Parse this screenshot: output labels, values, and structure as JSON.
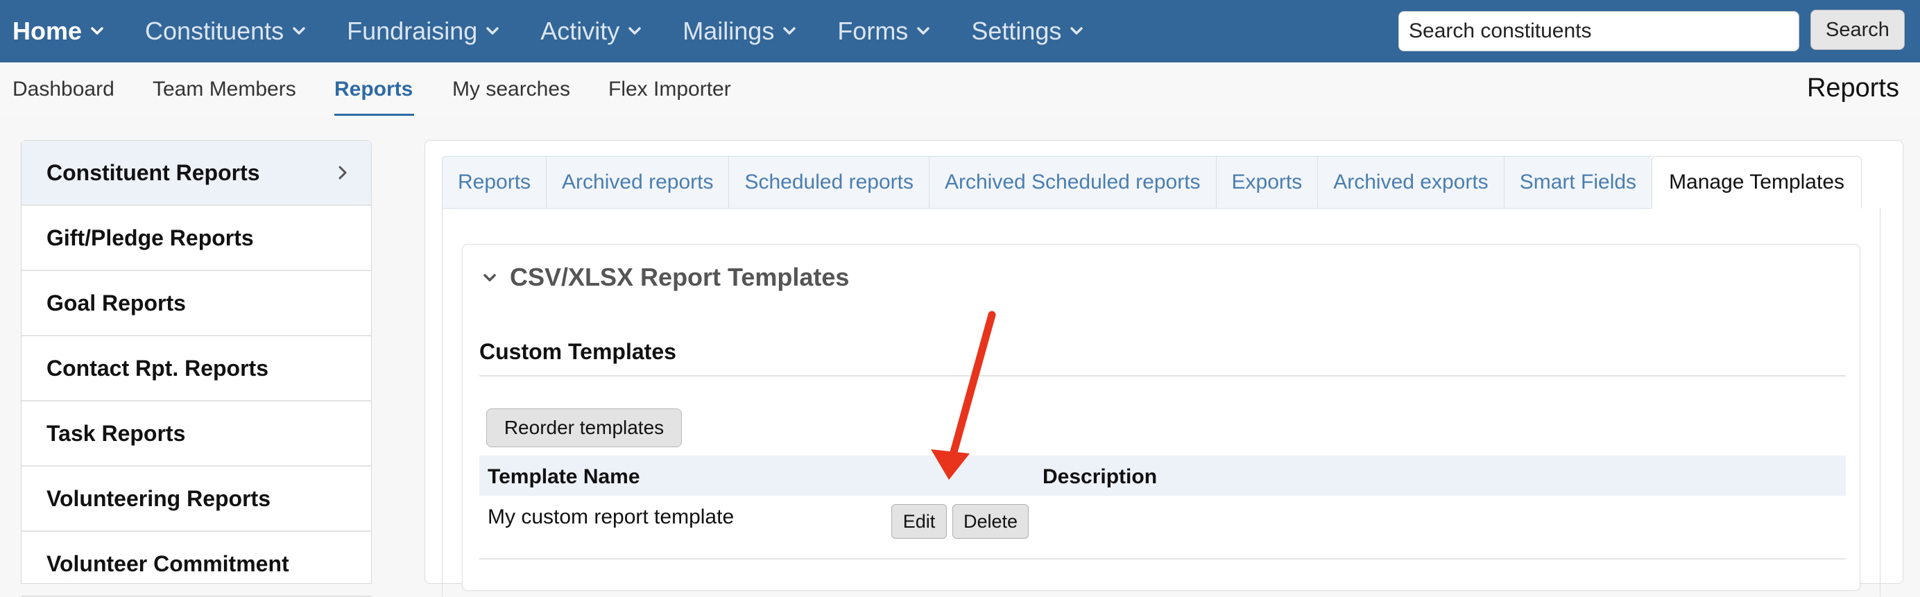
{
  "topnav": {
    "items": [
      {
        "label": "Home"
      },
      {
        "label": "Constituents"
      },
      {
        "label": "Fundraising"
      },
      {
        "label": "Activity"
      },
      {
        "label": "Mailings"
      },
      {
        "label": "Forms"
      },
      {
        "label": "Settings"
      }
    ],
    "search_placeholder": "Search constituents",
    "search_button": "Search",
    "bar_color": "#336699"
  },
  "subnav": {
    "items": [
      {
        "label": "Dashboard"
      },
      {
        "label": "Team Members"
      },
      {
        "label": "Reports"
      },
      {
        "label": "My searches"
      },
      {
        "label": "Flex Importer"
      }
    ],
    "active": "Reports",
    "page_title": "Reports"
  },
  "sidebar": {
    "items": [
      {
        "label": "Constituent Reports"
      },
      {
        "label": "Gift/Pledge Reports"
      },
      {
        "label": "Goal Reports"
      },
      {
        "label": "Contact Rpt. Reports"
      },
      {
        "label": "Task Reports"
      },
      {
        "label": "Volunteering Reports"
      },
      {
        "label": "Volunteer Commitment"
      }
    ]
  },
  "tabs": [
    {
      "label": "Reports"
    },
    {
      "label": "Archived reports"
    },
    {
      "label": "Scheduled reports"
    },
    {
      "label": "Archived Scheduled reports"
    },
    {
      "label": "Exports"
    },
    {
      "label": "Archived exports"
    },
    {
      "label": "Smart Fields"
    },
    {
      "label": "Manage Templates"
    }
  ],
  "active_tab": "Manage Templates",
  "templates": {
    "card_title": "CSV/XLSX Report Templates",
    "section_title": "Custom Templates",
    "reorder_button": "Reorder templates",
    "columns": {
      "name": "Template Name",
      "description": "Description"
    },
    "rows": [
      {
        "name": "My custom report template",
        "description": "",
        "edit": "Edit",
        "delete": "Delete"
      }
    ]
  },
  "annotation": {
    "arrow_color": "#e8341c"
  }
}
